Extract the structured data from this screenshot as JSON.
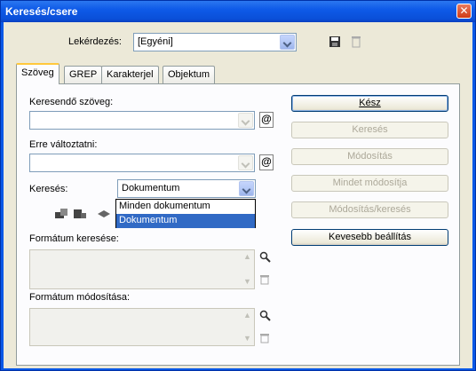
{
  "window": {
    "title": "Keresés/csere",
    "close_glyph": "✕"
  },
  "query": {
    "label": "Lekérdezés:",
    "value": "[Egyéni]",
    "save_icon": "save-icon",
    "delete_icon": "trash-icon"
  },
  "tabs": [
    {
      "label": "Szöveg",
      "active": true
    },
    {
      "label": "GREP",
      "active": false
    },
    {
      "label": "Karakterjel",
      "active": false
    },
    {
      "label": "Objektum",
      "active": false
    }
  ],
  "find": {
    "label": "Keresendő szöveg:",
    "value": "",
    "special_char_glyph": "@"
  },
  "change": {
    "label": "Erre változtatni:",
    "value": "",
    "special_char_glyph": "@"
  },
  "search": {
    "label": "Keresés:",
    "value": "Dokumentum",
    "options": [
      "Minden dokumentum",
      "Dokumentum"
    ],
    "selected_option": "Dokumentum"
  },
  "format_find": {
    "label": "Formátum keresése:"
  },
  "format_change": {
    "label": "Formátum módosítása:"
  },
  "buttons": [
    {
      "label": "Kész",
      "enabled": true
    },
    {
      "label": "Keresés",
      "enabled": false
    },
    {
      "label": "Módosítás",
      "enabled": false
    },
    {
      "label": "Mindet módosítja",
      "enabled": false
    },
    {
      "label": "Módosítás/keresés",
      "enabled": false
    },
    {
      "label": "Kevesebb beállítás",
      "enabled": true
    }
  ]
}
